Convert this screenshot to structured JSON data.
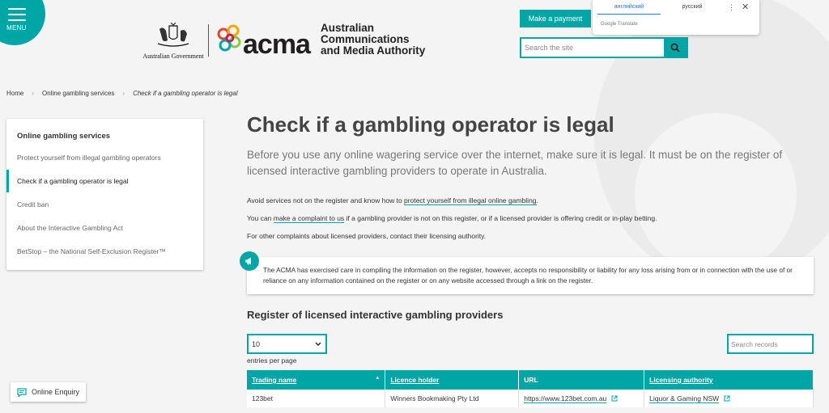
{
  "menu": {
    "label": "MENU"
  },
  "header": {
    "gov_logo_text": "Australian Government",
    "acma_word": "acma",
    "acma_full": [
      "Australian",
      "Communications",
      "and Media Authority"
    ],
    "make_payment": "Make a payment",
    "search_placeholder": "Search the site"
  },
  "translate": {
    "tabs": [
      "английский",
      "русский"
    ],
    "active_tab": 0,
    "brand": "Google Translate"
  },
  "breadcrumb": {
    "items": [
      "Home",
      "Online gambling services",
      "Check if a gambling operator is legal"
    ]
  },
  "sidebar": {
    "title": "Online gambling services",
    "items": [
      {
        "label": "Protect yourself from illegal gambling operators"
      },
      {
        "label": "Check if a gambling operator is legal",
        "active": true
      },
      {
        "label": "Credit ban"
      },
      {
        "label": "About the Interactive Gambling Act"
      },
      {
        "label": "BetStop – the National Self-Exclusion Register™"
      }
    ]
  },
  "enquiry": {
    "label": "Online Enquiry"
  },
  "main": {
    "title": "Check if a gambling operator is legal",
    "lead": "Before you use any online wagering service over the internet, make sure it is legal. It must be on the register of licensed interactive gambling providers to operate in Australia.",
    "p1": {
      "before": "Avoid services not on the register and know how to ",
      "link": "protect yourself from illegal online gambling",
      "after": "."
    },
    "p2": {
      "before": "You can ",
      "link": "make a complaint to us",
      "after": " if a gambling provider is not on this register, or if a licensed provider is offering credit or in-play betting."
    },
    "p3": "For other complaints about licensed providers, contact their licensing authority.",
    "disclaimer": "The ACMA has exercised care in compiling the information on the register, however, accepts no responsibility or liability for any loss arising from or in connection with the use of or reliance on any information contained on the register or on any website accessed through a link on the register."
  },
  "register": {
    "title": "Register of licensed interactive gambling providers",
    "entries_value": "10",
    "entries_label": "entries per page",
    "search_placeholder": "Search records",
    "columns": [
      "Trading name",
      "Licence holder",
      "URL",
      "Licensing authority"
    ],
    "rows": [
      {
        "trading_name": "123bet",
        "licence_holder": "Winners Bookmaking Pty Ltd",
        "url": "https://www.123bet.com.au",
        "authority": "Liquor & Gaming NSW"
      }
    ]
  },
  "colors": {
    "accent": "#00a6a6",
    "background": "#f4f4f4"
  }
}
